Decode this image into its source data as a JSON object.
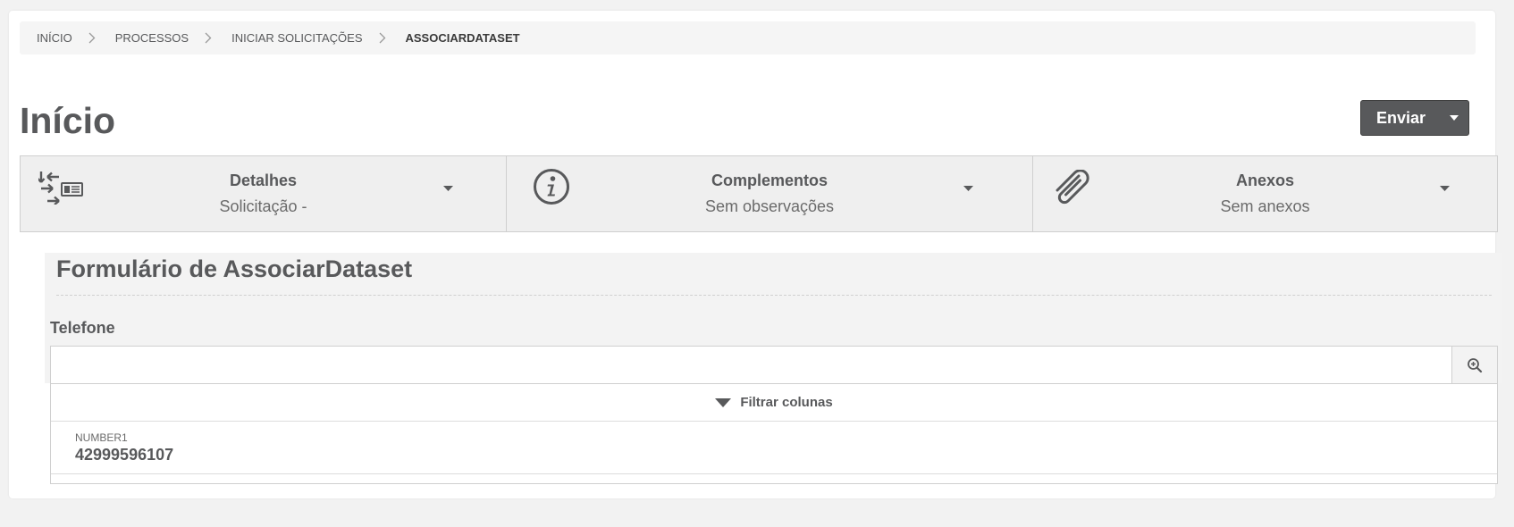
{
  "breadcrumb": {
    "items": [
      "INÍCIO",
      "PROCESSOS",
      "INICIAR SOLICITAÇÕES",
      "ASSOCIARDATASET"
    ]
  },
  "page": {
    "title": "Início"
  },
  "send": {
    "label": "Enviar"
  },
  "tabs": [
    {
      "title": "Detalhes",
      "subtitle": "Solicitação -",
      "icon": "swap-document-icon"
    },
    {
      "title": "Complementos",
      "subtitle": "Sem observações",
      "icon": "info-circle-icon"
    },
    {
      "title": "Anexos",
      "subtitle": "Sem anexos",
      "icon": "paperclip-icon"
    }
  ],
  "form": {
    "title": "Formulário de AssociarDataset",
    "field_label": "Telefone",
    "input_value": "",
    "filter_label": "Filtrar colunas",
    "results": [
      {
        "column": "NUMBER1",
        "value": "42999596107"
      }
    ]
  },
  "colors": {
    "primary": "#58595b",
    "tab_bg": "#efefef",
    "page_bg": "#f2f2f2"
  }
}
